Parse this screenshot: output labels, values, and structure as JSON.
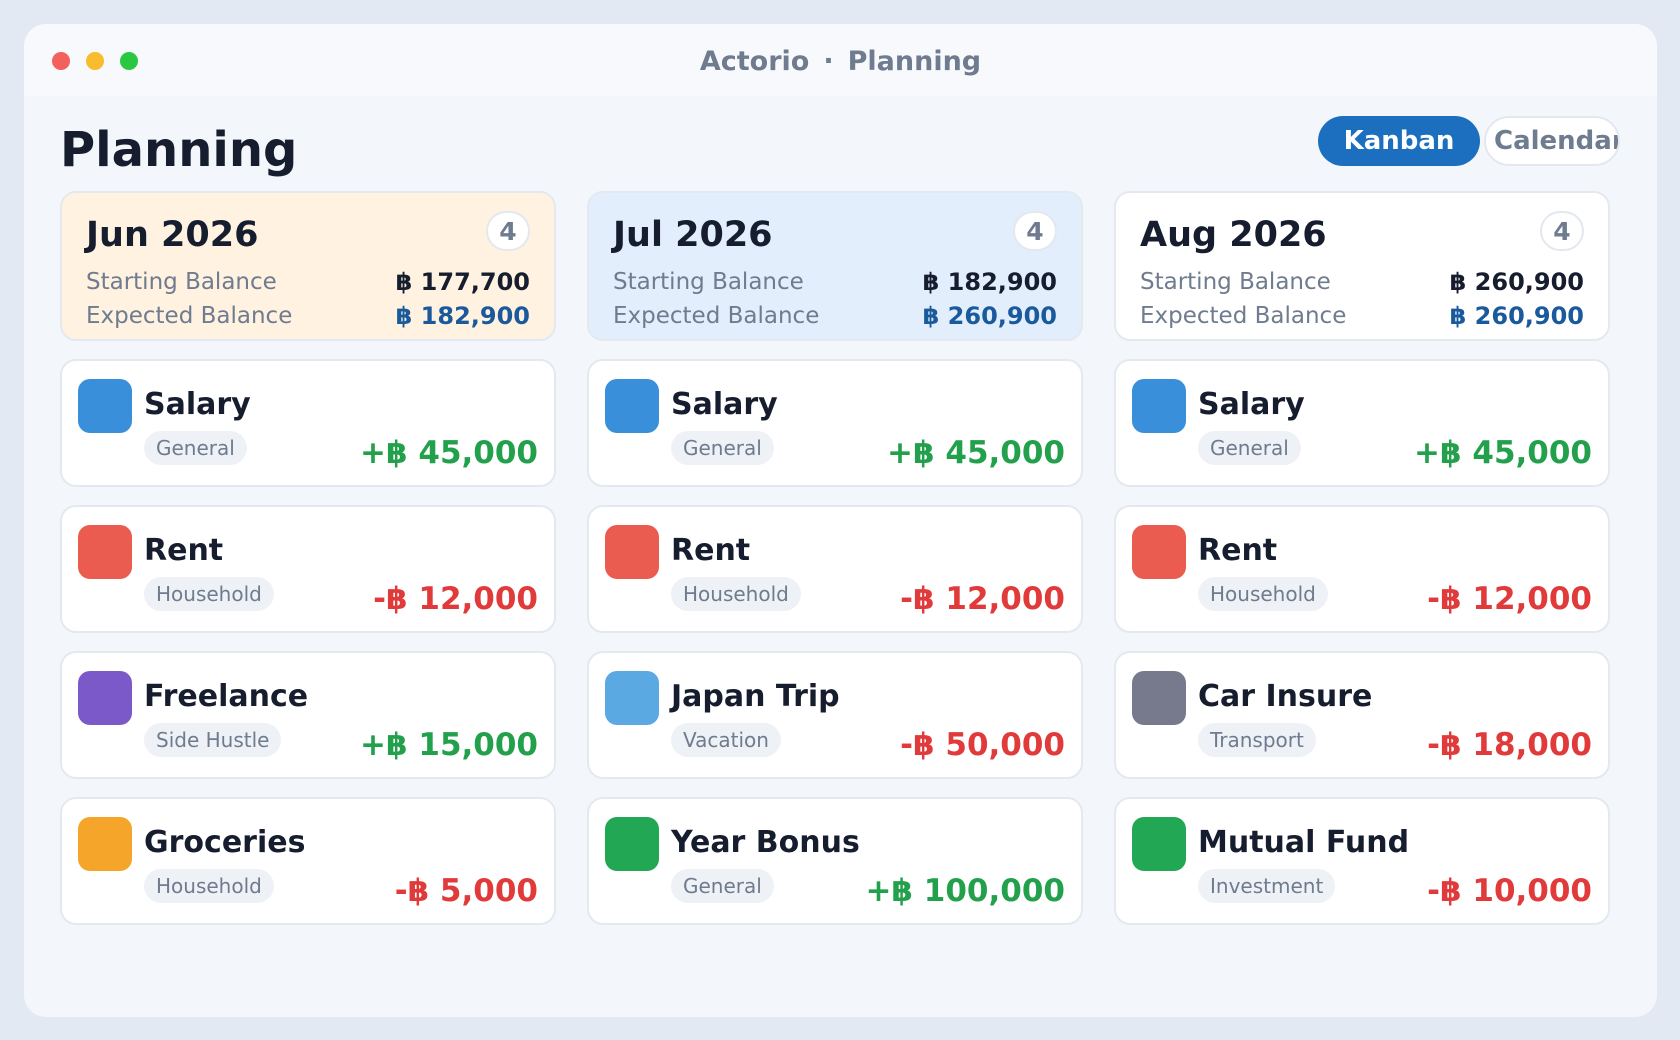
{
  "window": {
    "app_name": "Actorio",
    "separator": "·",
    "section": "Planning"
  },
  "page": {
    "title": "Planning"
  },
  "view_toggle": {
    "kanban": "Kanban",
    "calendar": "Calendar"
  },
  "labels": {
    "starting": "Starting Balance",
    "expected": "Expected Balance"
  },
  "colors": {
    "accent": "#1c6fbf",
    "positive": "#22a04b",
    "negative": "#e03a3a",
    "expected_balance": "#1a5a9c"
  },
  "columns": [
    {
      "month": "Jun 2026",
      "count": "4",
      "bg": "#fff2e1",
      "starting": "฿ 177,700",
      "expected": "฿ 182,900",
      "items": [
        {
          "name": "Salary",
          "category": "General",
          "amount": "+฿ 45,000",
          "sign": "pos",
          "color": "#3a8fdb"
        },
        {
          "name": "Rent",
          "category": "Household",
          "amount": "-฿ 12,000",
          "sign": "neg",
          "color": "#ea5c50"
        },
        {
          "name": "Freelance",
          "category": "Side Hustle",
          "amount": "+฿ 15,000",
          "sign": "pos",
          "color": "#7b59c9"
        },
        {
          "name": "Groceries",
          "category": "Household",
          "amount": "-฿ 5,000",
          "sign": "neg",
          "color": "#f4a52a"
        }
      ]
    },
    {
      "month": "Jul 2026",
      "count": "4",
      "bg": "#e2eefc",
      "starting": "฿ 182,900",
      "expected": "฿ 260,900",
      "items": [
        {
          "name": "Salary",
          "category": "General",
          "amount": "+฿ 45,000",
          "sign": "pos",
          "color": "#3a8fdb"
        },
        {
          "name": "Rent",
          "category": "Household",
          "amount": "-฿ 12,000",
          "sign": "neg",
          "color": "#ea5c50"
        },
        {
          "name": "Japan Trip",
          "category": "Vacation",
          "amount": "-฿ 50,000",
          "sign": "neg",
          "color": "#5aa9e3"
        },
        {
          "name": "Year Bonus",
          "category": "General",
          "amount": "+฿ 100,000",
          "sign": "pos",
          "color": "#22a855"
        }
      ]
    },
    {
      "month": "Aug 2026",
      "count": "4",
      "bg": "#ffffff",
      "starting": "฿ 260,900",
      "expected": "฿ 260,900",
      "items": [
        {
          "name": "Salary",
          "category": "General",
          "amount": "+฿ 45,000",
          "sign": "pos",
          "color": "#3a8fdb"
        },
        {
          "name": "Rent",
          "category": "Household",
          "amount": "-฿ 12,000",
          "sign": "neg",
          "color": "#ea5c50"
        },
        {
          "name": "Car Insure",
          "category": "Transport",
          "amount": "-฿ 18,000",
          "sign": "neg",
          "color": "#777a8c"
        },
        {
          "name": "Mutual Fund",
          "category": "Investment",
          "amount": "-฿ 10,000",
          "sign": "neg",
          "color": "#22a855"
        }
      ]
    }
  ]
}
